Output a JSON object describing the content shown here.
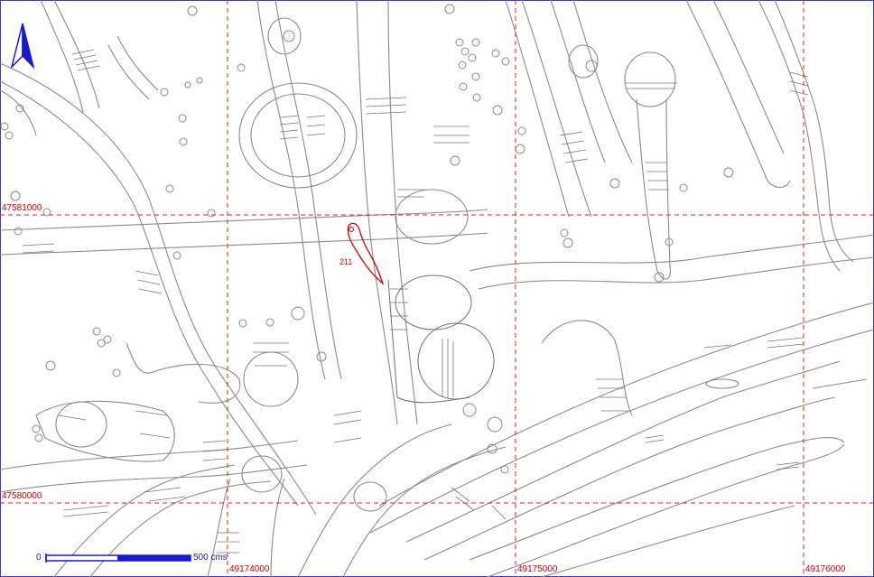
{
  "map": {
    "grid": {
      "x_labels": [
        "49174000",
        "49175000",
        "49176000"
      ],
      "y_labels": [
        "47581000",
        "47580000"
      ]
    },
    "feature_label": "211",
    "scale_bar": {
      "start_label": "0",
      "end_label": "500 cms"
    },
    "north_arrow_icon": "north-arrow-icon",
    "colors": {
      "grid": "#dd2222",
      "features": "#8a8a8a",
      "selected_feature": "#dd0000",
      "scale_bar": "#1a1acc"
    }
  }
}
